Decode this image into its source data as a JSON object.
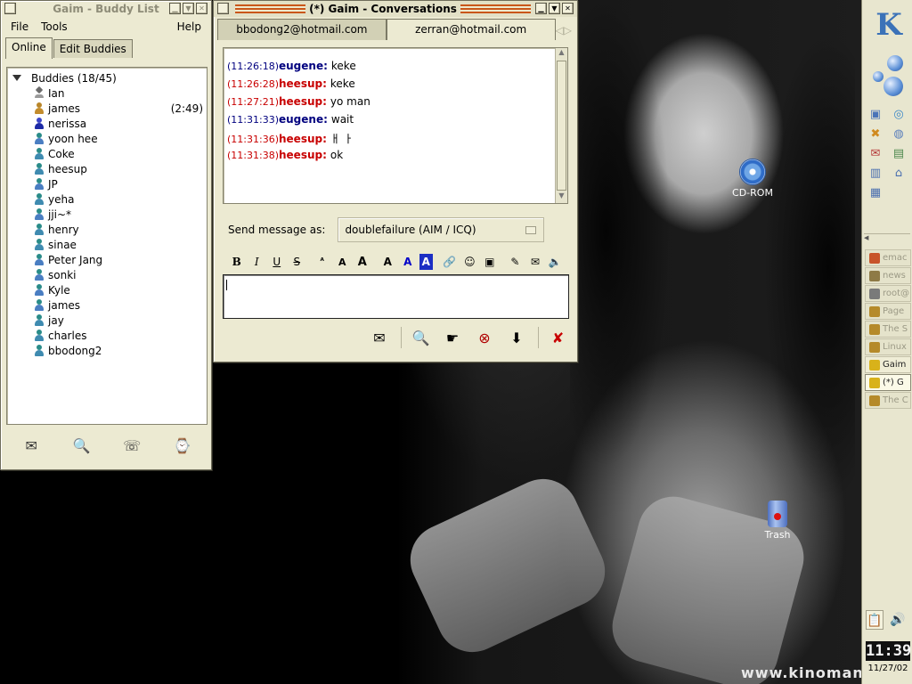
{
  "desktop": {
    "icons": [
      {
        "label": "CD-ROM"
      },
      {
        "label": "Trash"
      }
    ],
    "watermark": "www.kinoman"
  },
  "buddy_window": {
    "title": "Gaim - Buddy List",
    "menu": [
      "File",
      "Tools",
      "Help"
    ],
    "tabs": [
      "Online",
      "Edit Buddies"
    ],
    "group": "Buddies (18/45)",
    "buddies": [
      {
        "name": "Ian",
        "icon": "jabber-icon",
        "idle": ""
      },
      {
        "name": "james",
        "icon": "idle-buddy-icon",
        "idle": "(2:49)"
      },
      {
        "name": "nerissa",
        "icon": "yahoo-icon",
        "idle": ""
      },
      {
        "name": "yoon hee",
        "icon": "msn-buddy-icon",
        "idle": ""
      },
      {
        "name": "Coke",
        "icon": "buddy-icon",
        "idle": ""
      },
      {
        "name": "heesup",
        "icon": "buddy-icon",
        "idle": ""
      },
      {
        "name": "JP",
        "icon": "msn-buddy-icon",
        "idle": ""
      },
      {
        "name": "yeha",
        "icon": "buddy-icon",
        "idle": ""
      },
      {
        "name": "jji~*",
        "icon": "msn-buddy-icon",
        "idle": ""
      },
      {
        "name": "henry",
        "icon": "buddy-icon",
        "idle": ""
      },
      {
        "name": "sinae",
        "icon": "buddy-icon",
        "idle": ""
      },
      {
        "name": "Peter Jang",
        "icon": "msn-buddy-icon",
        "idle": ""
      },
      {
        "name": "sonki",
        "icon": "msn-buddy-icon",
        "idle": ""
      },
      {
        "name": "Kyle",
        "icon": "msn-buddy-icon",
        "idle": ""
      },
      {
        "name": "james",
        "icon": "msn-buddy-icon",
        "idle": ""
      },
      {
        "name": "jay",
        "icon": "buddy-icon",
        "idle": ""
      },
      {
        "name": "charles",
        "icon": "buddy-icon",
        "idle": ""
      },
      {
        "name": "bbodong2",
        "icon": "buddy-icon",
        "idle": ""
      }
    ]
  },
  "conv_window": {
    "title": "(*) Gaim - Conversations",
    "tabs": [
      "bbodong2@hotmail.com",
      "zerran@hotmail.com"
    ],
    "messages": [
      {
        "time": "(11:26:18)",
        "who": "eugene:",
        "text": "keke",
        "color": "blue"
      },
      {
        "time": "(11:26:28)",
        "who": "heesup:",
        "text": "keke",
        "color": "red"
      },
      {
        "time": "(11:27:21)",
        "who": "heesup:",
        "text": "yo man",
        "color": "red"
      },
      {
        "time": "(11:31:33)",
        "who": "eugene:",
        "text": "wait",
        "color": "blue"
      },
      {
        "time": "(11:31:36)",
        "who": "heesup:",
        "text": "ㅐ ㅏ",
        "color": "red"
      },
      {
        "time": "(11:31:38)",
        "who": "heesup:",
        "text": "ok",
        "color": "red"
      }
    ],
    "send_as_label": "Send message as:",
    "send_as_value": "doublefailure (AIM / ICQ)",
    "entry_text": ""
  },
  "panel": {
    "k_label": "K",
    "tasks": [
      {
        "label": "emac",
        "state": "off"
      },
      {
        "label": "news",
        "state": "off"
      },
      {
        "label": "root@",
        "state": "off"
      },
      {
        "label": "Page",
        "state": "off"
      },
      {
        "label": "The S",
        "state": "off"
      },
      {
        "label": "Linux",
        "state": "off"
      },
      {
        "label": "Gaim",
        "state": "on"
      },
      {
        "label": "(*) G",
        "state": "sel"
      },
      {
        "label": "The C",
        "state": "off"
      }
    ],
    "clock": "11:39",
    "date": "11/27/02"
  },
  "colors": {
    "window_bg": "#ecead2",
    "title_stripe": "#c9571a",
    "name_red": "#c80000",
    "name_blue": "#00007f"
  }
}
